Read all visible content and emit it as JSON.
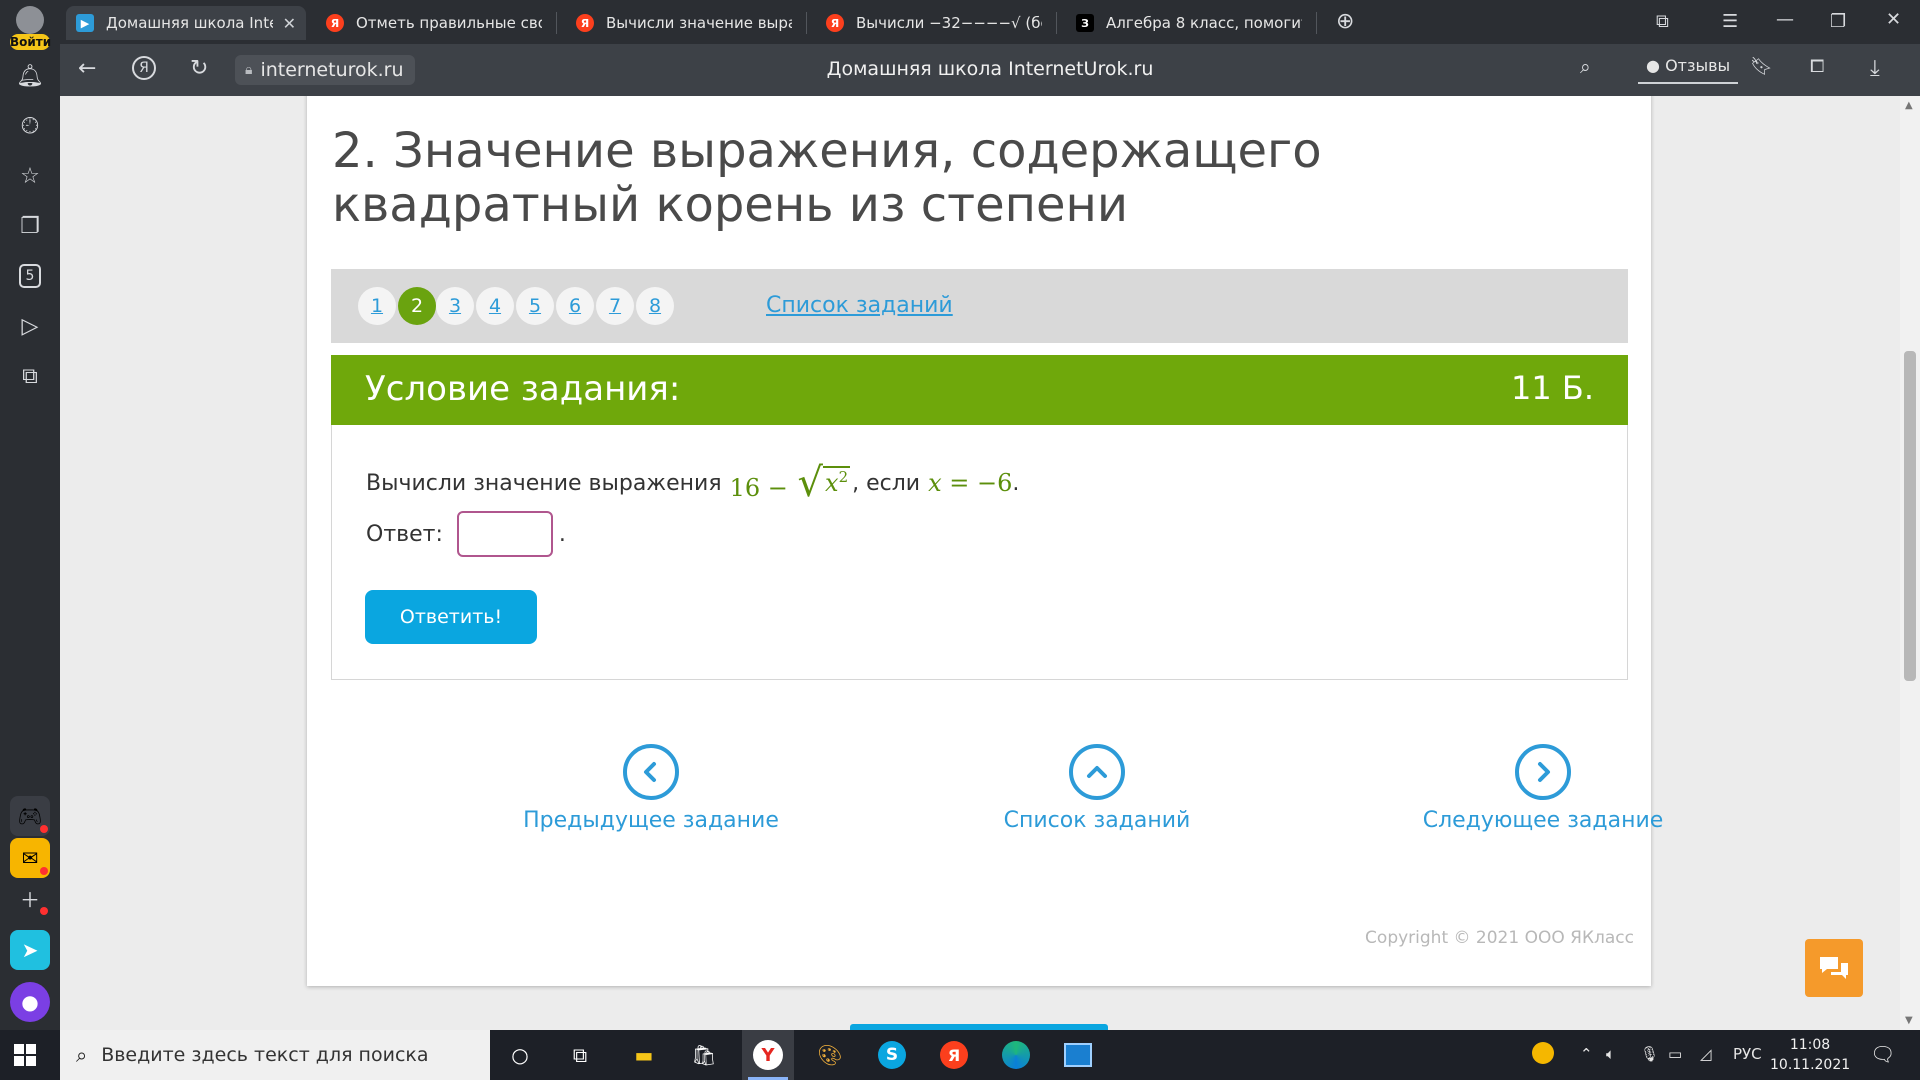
{
  "browser": {
    "login_label": "Войти",
    "tabs": [
      {
        "title": "Домашняя школа Interr",
        "active": true,
        "icon": "internetUrok-icon",
        "icon_color": "#2d9bd8"
      },
      {
        "title": "Отметь правильные свой",
        "active": false,
        "icon": "yandex-icon",
        "icon_color": "#fc3f1d"
      },
      {
        "title": "Вычисли значение выраж",
        "active": false,
        "icon": "yandex-icon",
        "icon_color": "#fc3f1d"
      },
      {
        "title": "Вычисли −32−−−−√ (без",
        "active": false,
        "icon": "yandex-icon",
        "icon_color": "#fc3f1d"
      },
      {
        "title": "Алгебра 8 класс, помогите",
        "active": false,
        "icon": "znanija-icon",
        "icon_color": "#000000"
      }
    ],
    "url": "interneturok.ru",
    "page_title": "Домашняя школа InternetUrok.ru",
    "reviews_label": "Отзывы",
    "sidebar_badge": "5"
  },
  "page": {
    "lesson_title": "2. Значение выражения, содержащего квадратный корень из степени",
    "task_numbers": [
      "1",
      "2",
      "3",
      "4",
      "5",
      "6",
      "7",
      "8"
    ],
    "current_task": "2",
    "task_list_label": "Список заданий",
    "condition_title": "Условие задания:",
    "points": "11 Б.",
    "question_text": "Вычисли значение выражения",
    "math": {
      "a": "16",
      "minus": "−",
      "var": "x",
      "exp": "2",
      "cond_var": "x",
      "eq": "=",
      "cond_val": "−6"
    },
    "question_if": ", если",
    "question_end": ".",
    "answer_label": "Ответ:",
    "answer_value": "",
    "answer_suffix": ".",
    "submit_label": "Ответить!",
    "nav": {
      "prev": "Предыдущее задание",
      "list": "Список заданий",
      "next": "Следующее задание"
    },
    "copyright": "Copyright © 2021 ООО ЯКласс",
    "accent_green": "#6fa80b",
    "accent_blue": "#0aa6e0",
    "link_blue": "#2d9bd8"
  },
  "taskbar": {
    "search_placeholder": "Введите здесь текст для поиска",
    "lang": "РУС",
    "time": "11:08",
    "date": "10.11.2021"
  }
}
